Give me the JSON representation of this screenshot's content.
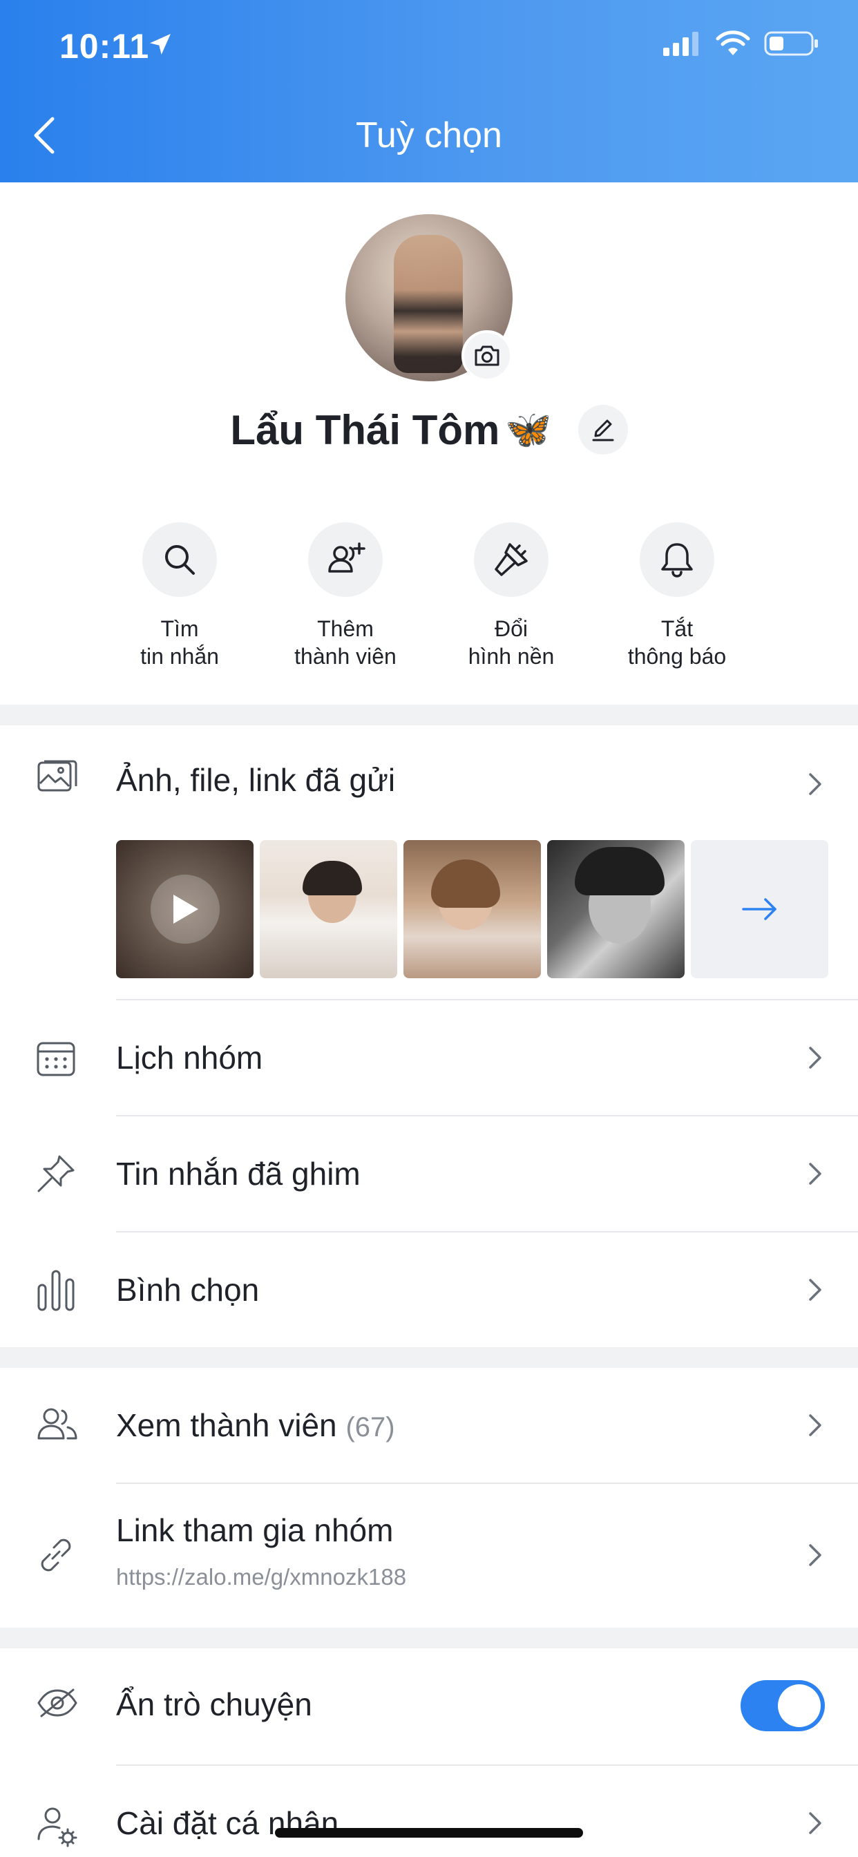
{
  "status_bar": {
    "time": "10:11"
  },
  "header": {
    "title": "Tuỳ chọn"
  },
  "profile": {
    "name": "Lẩu Thái Tôm",
    "name_emoji": "🦋"
  },
  "quick_actions": [
    {
      "line1": "Tìm",
      "line2": "tin nhắn",
      "icon": "search-icon"
    },
    {
      "line1": "Thêm",
      "line2": "thành viên",
      "icon": "add-member-icon"
    },
    {
      "line1": "Đổi",
      "line2": "hình nền",
      "icon": "paint-brush-icon"
    },
    {
      "line1": "Tắt",
      "line2": "thông báo",
      "icon": "bell-icon"
    }
  ],
  "media": {
    "label": "Ảnh, file, link đã gửi"
  },
  "menu": {
    "calendar": "Lịch nhóm",
    "pinned": "Tin nhắn đã ghim",
    "poll": "Bình chọn",
    "members": "Xem thành viên",
    "members_count": "(67)",
    "invite_link": "Link tham gia nhóm",
    "invite_url": "https://zalo.me/g/xmnozk188",
    "hide_chat": "Ẩn trò chuyện",
    "hide_chat_on": true,
    "personal_settings": "Cài đặt cá nhân"
  },
  "colors": {
    "accent": "#2b82f0",
    "header_start": "#2a80ec",
    "header_end": "#5aa6f3"
  }
}
